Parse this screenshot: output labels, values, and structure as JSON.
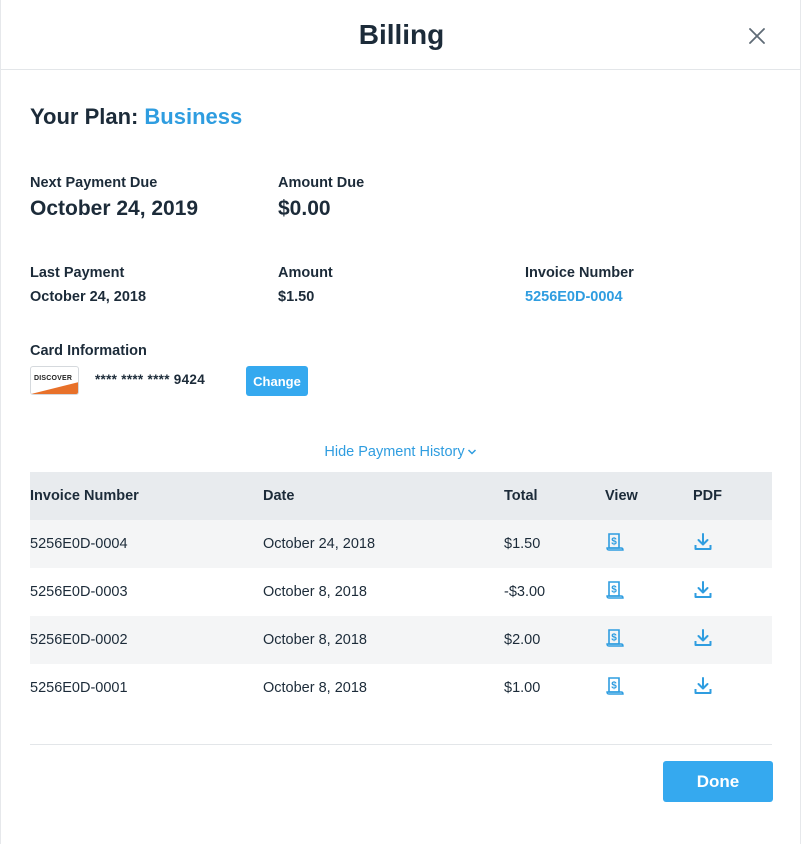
{
  "header": {
    "title": "Billing",
    "close_icon": "close-icon"
  },
  "plan": {
    "label": "Your Plan:",
    "name": "Business"
  },
  "next_payment": {
    "label": "Next Payment Due",
    "value": "October 24, 2019"
  },
  "amount_due": {
    "label": "Amount Due",
    "value": "$0.00"
  },
  "last_payment": {
    "label": "Last Payment",
    "value": "October 24, 2018"
  },
  "amount": {
    "label": "Amount",
    "value": "$1.50"
  },
  "invoice": {
    "label": "Invoice Number",
    "value": "5256E0D-0004"
  },
  "card": {
    "label": "Card Information",
    "brand": "DISCOVER",
    "number": "**** **** **** 9424",
    "change_label": "Change"
  },
  "history_toggle": {
    "label": "Hide Payment History",
    "icon": "chevron-down-icon"
  },
  "table": {
    "headers": [
      "Invoice Number",
      "Date",
      "Total",
      "View",
      "PDF"
    ],
    "rows": [
      {
        "invoice": "5256E0D-0004",
        "date": "October 24, 2018",
        "total": "$1.50"
      },
      {
        "invoice": "5256E0D-0003",
        "date": "October 8, 2018",
        "total": "-$3.00"
      },
      {
        "invoice": "5256E0D-0002",
        "date": "October 8, 2018",
        "total": "$2.00"
      },
      {
        "invoice": "5256E0D-0001",
        "date": "October 8, 2018",
        "total": "$1.00"
      }
    ],
    "view_icon": "receipt-icon",
    "pdf_icon": "download-icon"
  },
  "footer": {
    "done_label": "Done"
  },
  "colors": {
    "accent": "#35a9ef",
    "link": "#2f9de0",
    "text": "#1c2b39",
    "header_bg": "#e8ebee",
    "stripe_bg": "#f4f5f6"
  }
}
